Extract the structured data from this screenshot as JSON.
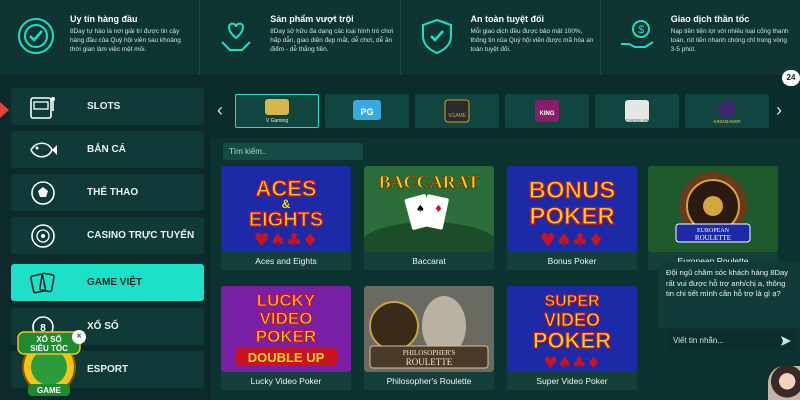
{
  "features": [
    {
      "title": "Uy tín hàng đầu",
      "desc": "8Day tự hào là nơi giải trí được tin cậy hàng đầu của Quý hội viên sau khoảng thời gian làm việc mệt mỏi.",
      "icon": "check-badge-icon"
    },
    {
      "title": "Sản phẩm vượt trội",
      "desc": "8Day sở hữu đa dạng các loại hình trò chơi hấp dẫn, giao diện đẹp mắt, dễ chơi, dễ ăn điểm - dễ thắng tiền.",
      "icon": "heart-hands-icon"
    },
    {
      "title": "An toàn tuyệt đối",
      "desc": "Mỗi giao dịch đều được bảo mật 100%, thông tin của Quý hội viên được mã hóa an toàn tuyệt đối.",
      "icon": "shield-icon"
    },
    {
      "title": "Giao dịch thần tốc",
      "desc": "Nạp tiền tiện lợi với nhiều loại cổng thanh toán, rút tiền nhanh chóng chỉ trong vòng 3-5 phút.",
      "icon": "money-hand-icon"
    }
  ],
  "sidebar": {
    "items": [
      {
        "label": "SLOTS",
        "icon": "slot-machine-icon"
      },
      {
        "label": "BẮN CÁ",
        "icon": "fish-icon"
      },
      {
        "label": "THỂ THAO",
        "icon": "soccer-ball-icon"
      },
      {
        "label": "CASINO TRỰC TUYẾN",
        "icon": "roulette-icon"
      },
      {
        "label": "GAME VIỆT",
        "icon": "cards-icon"
      },
      {
        "label": "XỔ SỐ",
        "icon": "lottery-ball-icon"
      },
      {
        "label": "ESPORT",
        "icon": "gamepad-icon"
      }
    ],
    "active_index": 4,
    "promo": {
      "line1": "XỔ SỐ",
      "line2": "SIÊU TỐC",
      "line3": "GAME"
    }
  },
  "providers": {
    "items": [
      {
        "label": "V Gaming"
      },
      {
        "label": "PG"
      },
      {
        "label": "VGAME"
      },
      {
        "label": "KING"
      },
      {
        "label": "CHESS.VN"
      },
      {
        "label": "KINGMAKER"
      }
    ]
  },
  "search": {
    "placeholder": "Tìm kiếm.."
  },
  "games": [
    {
      "name": "Aces and Eights",
      "art_l1": "ACES",
      "art_l2": "&",
      "art_l3": "EIGHTS"
    },
    {
      "name": "Baccarat",
      "art_l1": "BACCARAT"
    },
    {
      "name": "Bonus Poker",
      "art_l1": "BONUS",
      "art_l2": "POKER"
    },
    {
      "name": "European Roulette",
      "art_l1": "EUROPEAN",
      "art_l2": "ROULETTE"
    },
    {
      "name": "Lucky Video Poker",
      "art_l1": "LUCKY",
      "art_l2": "VIDEO",
      "art_l3": "POKER",
      "art_l4": "DOUBLE UP"
    },
    {
      "name": "Philosopher's Roulette",
      "art_l1": "PHILOSOPHER'S",
      "art_l2": "ROULETTE"
    },
    {
      "name": "Super Video Poker",
      "art_l1": "SUPER",
      "art_l2": "VIDEO",
      "art_l3": "POKER"
    }
  ],
  "chat": {
    "message": "Đội ngũ chăm sóc khách hàng 8Day rất vui được hỗ trợ anh/chị a, thông tin chi tiết mình cần hỗ trợ là gì ạ?",
    "input_placeholder": "Viết tin nhắn...",
    "badge": "24"
  },
  "colors": {
    "accent": "#1ee0c8",
    "bg": "#0b2a29",
    "panel": "#0d3330",
    "card_red": "#c8141e",
    "card_blue": "#1c2aa8"
  }
}
